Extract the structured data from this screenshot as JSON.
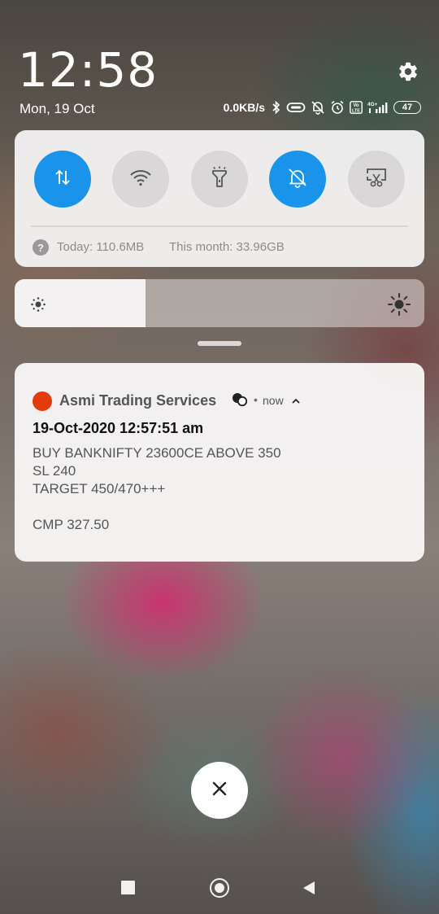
{
  "status": {
    "time": "12:58",
    "date": "Mon, 19 Oct",
    "net_speed": "0.0KB/s",
    "network_label": "4G+",
    "volte_label": "Vo LTE",
    "battery_level": "47",
    "icons": [
      "bluetooth-icon",
      "link-icon",
      "silent-icon",
      "alarm-icon",
      "volte-icon",
      "signal-icon",
      "battery-icon"
    ]
  },
  "quick_settings": {
    "toggles": [
      {
        "name": "mobile-data",
        "icon": "data-arrows-icon",
        "on": true
      },
      {
        "name": "wifi",
        "icon": "wifi-icon",
        "on": false
      },
      {
        "name": "flashlight",
        "icon": "flashlight-icon",
        "on": false
      },
      {
        "name": "silent",
        "icon": "bell-off-icon",
        "on": true
      },
      {
        "name": "screenshot",
        "icon": "scissors-icon",
        "on": false
      }
    ],
    "usage_today": "Today: 110.6MB",
    "usage_month": "This month: 33.96GB",
    "help_glyph": "?"
  },
  "brightness": {
    "level": 0.32
  },
  "notification": {
    "app_name": "Asmi Trading Services",
    "separator": "•",
    "time": "now",
    "title": "19-Oct-2020 12:57:51 am",
    "lines": [
      "BUY BANKNIFTY 23600CE ABOVE 350",
      "SL 240",
      "TARGET 450/470+++",
      "CMP 327.50"
    ]
  },
  "colors": {
    "accent": "#1a94ea",
    "app_dot": "#e23c0c",
    "panel": "#f3f1f1"
  },
  "dismiss_glyph": "✕"
}
